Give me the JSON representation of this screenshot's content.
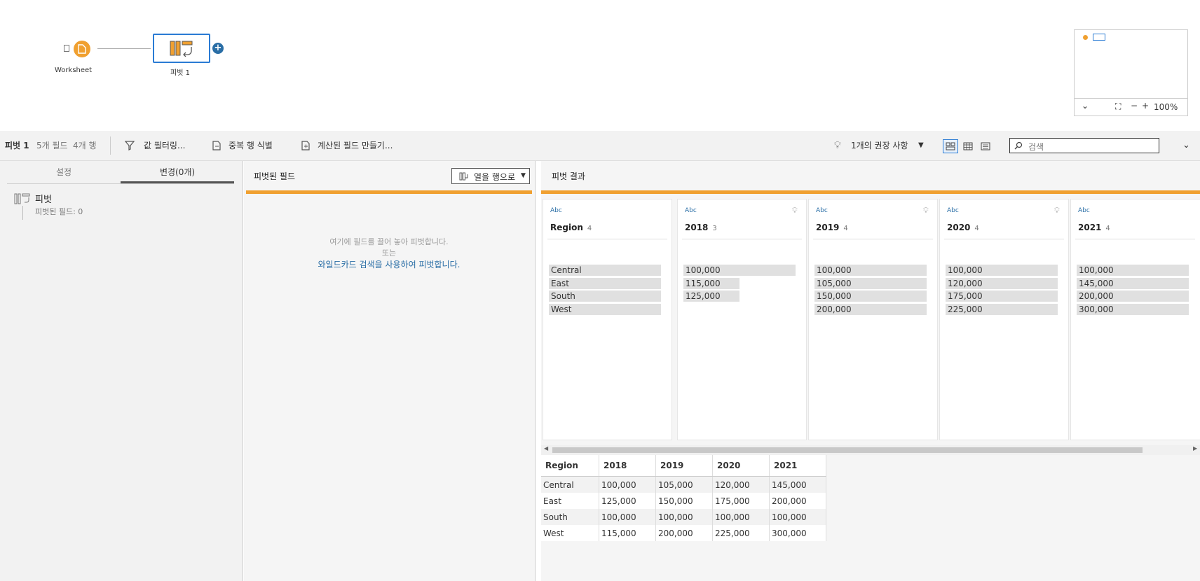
{
  "flow": {
    "input_node_label": "Worksheet",
    "pivot_node_label": "피벗 1",
    "minimap": {
      "zoom": "100%"
    }
  },
  "toolbar": {
    "step_name": "피벗 1",
    "field_count": "5개 필드",
    "row_count": "4개 행",
    "filter_values": "값 필터링...",
    "identify_duplicates": "중복 행 식별",
    "create_calc_field": "계산된 필드 만들기...",
    "recommendations": "1개의 권장 사항",
    "search_placeholder": "검색"
  },
  "left": {
    "tab_settings": "설정",
    "tab_changes": "변경(0개)",
    "change_title": "피벗",
    "change_detail": "피벗된 필드: 0"
  },
  "middle": {
    "title": "피벗된 필드",
    "pivot_mode": "열을 행으로",
    "drop_hint": "여기에 필드를 끌어 놓아 피벗합니다.",
    "or_text": "또는",
    "wildcard_link": "와일드카드 검색을 사용하여 피벗합니다."
  },
  "right": {
    "title": "피벗 결과",
    "cards": [
      {
        "type": "Abc",
        "name": "Region",
        "count": "4",
        "values": [
          {
            "label": "Central",
            "fraction": 1.0
          },
          {
            "label": "East",
            "fraction": 1.0
          },
          {
            "label": "South",
            "fraction": 1.0
          },
          {
            "label": "West",
            "fraction": 1.0
          }
        ]
      },
      {
        "type": "Abc",
        "name": "2018",
        "count": "3",
        "values": [
          {
            "label": "100,000",
            "fraction": 1.0
          },
          {
            "label": "115,000",
            "fraction": 0.5
          },
          {
            "label": "125,000",
            "fraction": 0.5
          }
        ]
      },
      {
        "type": "Abc",
        "name": "2019",
        "count": "4",
        "values": [
          {
            "label": "100,000",
            "fraction": 1.0
          },
          {
            "label": "105,000",
            "fraction": 1.0
          },
          {
            "label": "150,000",
            "fraction": 1.0
          },
          {
            "label": "200,000",
            "fraction": 1.0
          }
        ]
      },
      {
        "type": "Abc",
        "name": "2020",
        "count": "4",
        "values": [
          {
            "label": "100,000",
            "fraction": 1.0
          },
          {
            "label": "120,000",
            "fraction": 1.0
          },
          {
            "label": "175,000",
            "fraction": 1.0
          },
          {
            "label": "225,000",
            "fraction": 1.0
          }
        ]
      },
      {
        "type": "Abc",
        "name": "2021",
        "count": "4",
        "values": [
          {
            "label": "100,000",
            "fraction": 1.0
          },
          {
            "label": "145,000",
            "fraction": 1.0
          },
          {
            "label": "200,000",
            "fraction": 1.0
          },
          {
            "label": "300,000",
            "fraction": 1.0
          }
        ]
      }
    ],
    "table": {
      "headers": [
        "Region",
        "2018",
        "2019",
        "2020",
        "2021"
      ],
      "rows": [
        [
          "Central",
          "100,000",
          "105,000",
          "120,000",
          "145,000"
        ],
        [
          "East",
          "125,000",
          "150,000",
          "175,000",
          "200,000"
        ],
        [
          "South",
          "100,000",
          "100,000",
          "100,000",
          "100,000"
        ],
        [
          "West",
          "115,000",
          "200,000",
          "225,000",
          "300,000"
        ]
      ]
    }
  },
  "colors": {
    "accent": "#f0a030",
    "selection": "#2a7bd4",
    "link": "#2a6ea6"
  }
}
